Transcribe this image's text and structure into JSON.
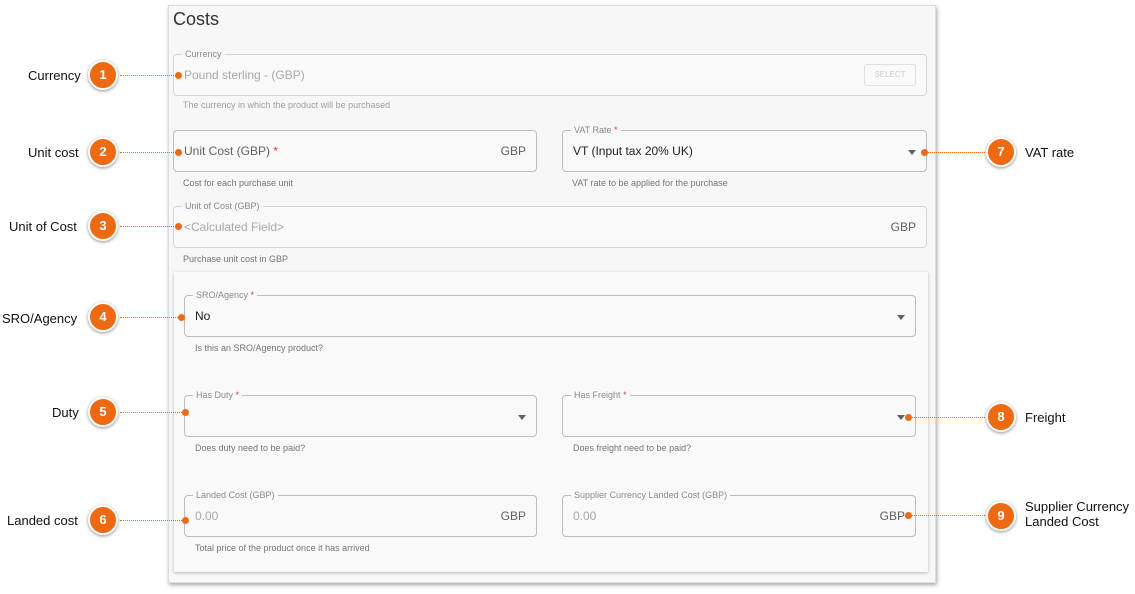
{
  "panel": {
    "title": "Costs"
  },
  "currency": {
    "legend": "Currency",
    "value": "Pound sterling - (GBP)",
    "select_label": "SELECT",
    "helper": "The currency in which the product will be purchased"
  },
  "unit_cost": {
    "placeholder": "Unit Cost (GBP)",
    "required_mark": "*",
    "suffix": "GBP",
    "helper": "Cost for each purchase unit"
  },
  "vat_rate": {
    "legend": "VAT Rate",
    "required_mark": "*",
    "value": "VT (Input tax 20% UK)",
    "helper": "VAT rate to be applied for the purchase"
  },
  "unit_of_cost": {
    "legend": "Unit of Cost (GBP)",
    "value": "<Calculated Field>",
    "suffix": "GBP",
    "helper": "Purchase unit cost in GBP"
  },
  "sro_agency": {
    "legend": "SRO/Agency",
    "required_mark": "*",
    "value": "No",
    "helper": "Is this an SRO/Agency product?"
  },
  "has_duty": {
    "legend": "Has Duty",
    "required_mark": "*",
    "value": "",
    "helper": "Does duty need to be paid?"
  },
  "has_freight": {
    "legend": "Has Freight",
    "required_mark": "*",
    "value": "",
    "helper": "Does freight need to be paid?"
  },
  "landed_cost": {
    "legend": "Landed Cost (GBP)",
    "value": "0.00",
    "suffix": "GBP",
    "helper": "Total price of the product once it has arrived"
  },
  "supplier_landed_cost": {
    "legend": "Supplier Currency Landed Cost (GBP)",
    "value": "0.00",
    "suffix": "GBP"
  },
  "callouts": [
    {
      "number": "1",
      "label": "Currency"
    },
    {
      "number": "2",
      "label": "Unit cost"
    },
    {
      "number": "3",
      "label": "Unit of Cost"
    },
    {
      "number": "4",
      "label": "SRO/Agency"
    },
    {
      "number": "5",
      "label": "Duty"
    },
    {
      "number": "6",
      "label": "Landed cost"
    },
    {
      "number": "7",
      "label": "VAT rate"
    },
    {
      "number": "8",
      "label": "Freight"
    },
    {
      "number": "9",
      "label_line1": "Supplier Currency",
      "label_line2": "Landed Cost"
    }
  ],
  "colors": {
    "accent": "#ee6a12",
    "required": "#e53935"
  }
}
